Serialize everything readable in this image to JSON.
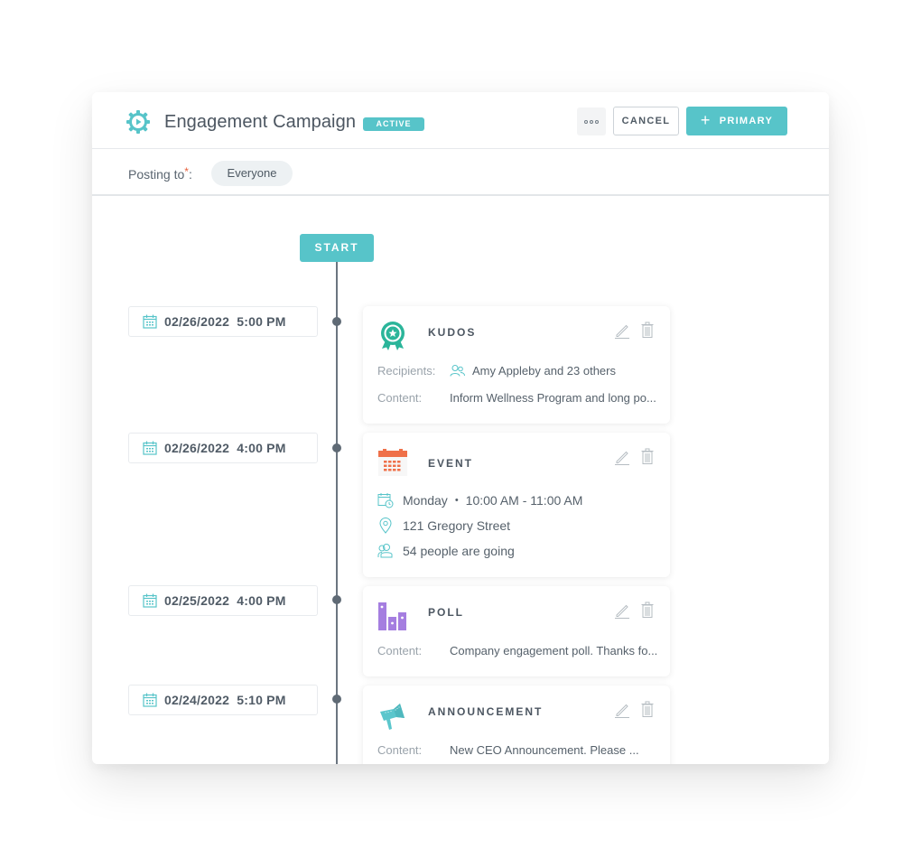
{
  "header": {
    "title": "Engagement Campaign",
    "status_badge": "ACTIVE",
    "more_label": "more-options",
    "cancel_label": "CANCEL",
    "primary_label": "PRIMARY",
    "primary_icon": "plus"
  },
  "posting": {
    "label": "Posting to",
    "required_mark": "*",
    "colon": ":",
    "audience": "Everyone"
  },
  "timeline": {
    "start_label": "START",
    "items": [
      {
        "date": "02/26/2022  5:00 PM",
        "type": "KUDOS",
        "icon": "award-ribbon-icon",
        "rows": [
          {
            "label": "Recipients:",
            "icon": "people-icon",
            "value": "Amy Appleby and 23 others"
          },
          {
            "label": "Content:",
            "value": "Inform Wellness Program and long po..."
          }
        ]
      },
      {
        "date": "02/26/2022  4:00 PM",
        "type": "EVENT",
        "icon": "calendar-icon",
        "rows": [
          {
            "icon": "calendar-clock-icon",
            "day": "Monday",
            "separator": "•",
            "time": "10:00 AM - 11:00 AM"
          },
          {
            "icon": "location-pin-icon",
            "value": "121 Gregory Street"
          },
          {
            "icon": "people-icon",
            "value": "54 people are going"
          }
        ]
      },
      {
        "date": "02/25/2022  4:00 PM",
        "type": "POLL",
        "icon": "poll-bars-icon",
        "rows": [
          {
            "label": "Content:",
            "value": "Company engagement poll. Thanks fo..."
          }
        ]
      },
      {
        "date": "02/24/2022  5:10 PM",
        "type": "ANNOUNCEMENT",
        "icon": "megaphone-icon",
        "rows": [
          {
            "label": "Content:",
            "value": "New CEO Announcement. Please ..."
          }
        ]
      }
    ]
  },
  "colors": {
    "accent": "#57c4c9",
    "required": "#e8603c",
    "kudos": "#2bb59a",
    "event": "#ef7049",
    "poll": "#a57ee0",
    "announcement": "#5bc6cc"
  }
}
